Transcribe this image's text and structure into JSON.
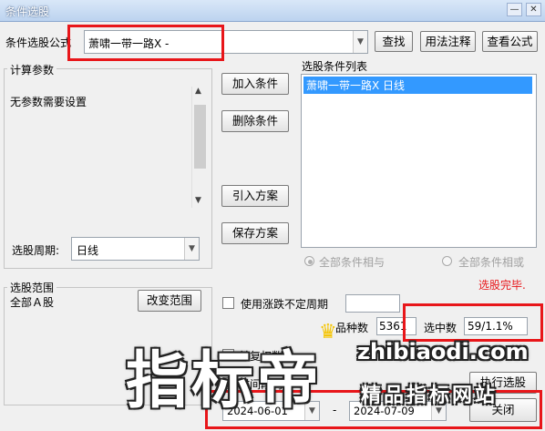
{
  "window": {
    "title": "条件选股",
    "minimize": "—",
    "close": "✕"
  },
  "formula": {
    "label": "条件选股公式",
    "value": "萧啸一带一路X  -",
    "dropdown_icon": "chevron-down-icon"
  },
  "buttons": {
    "find": "查找",
    "usage": "用法注释",
    "view_formula": "查看公式",
    "add_condition": "加入条件",
    "delete_condition": "删除条件",
    "import_plan": "引入方案",
    "save_plan": "保存方案",
    "change_range": "改变范围",
    "execute": "执行选股",
    "close": "关闭"
  },
  "params": {
    "title": "计算参数",
    "message": "无参数需要设置",
    "period_label": "选股周期:",
    "period_value": "日线"
  },
  "conditions": {
    "title": "选股条件列表",
    "items": [
      "萧啸一带一路X  日线"
    ],
    "and_label": "全部条件相与",
    "or_label": "全部条件相或"
  },
  "status": {
    "message": "选股完毕.",
    "message_color": "#e8161a"
  },
  "range": {
    "title": "选股范围",
    "value": "全部Ａ股"
  },
  "options": {
    "use_uncertain_period": "使用涨跌不定周期",
    "pre_rights": "前复权数据",
    "in_period": "时间段内"
  },
  "stats": {
    "total_label": "品种数",
    "total_value": "5361",
    "selected_label": "选中数",
    "selected_value": "59/1.1%"
  },
  "dates": {
    "start": "2024-06-01",
    "separator": "-",
    "end": "2024-07-09"
  },
  "watermark": {
    "big": "指标帝",
    "url": "zhibiaodi.com",
    "sub": "精品指标网站"
  },
  "accent_color": "#3399ff",
  "highlight_color": "#e8161a"
}
